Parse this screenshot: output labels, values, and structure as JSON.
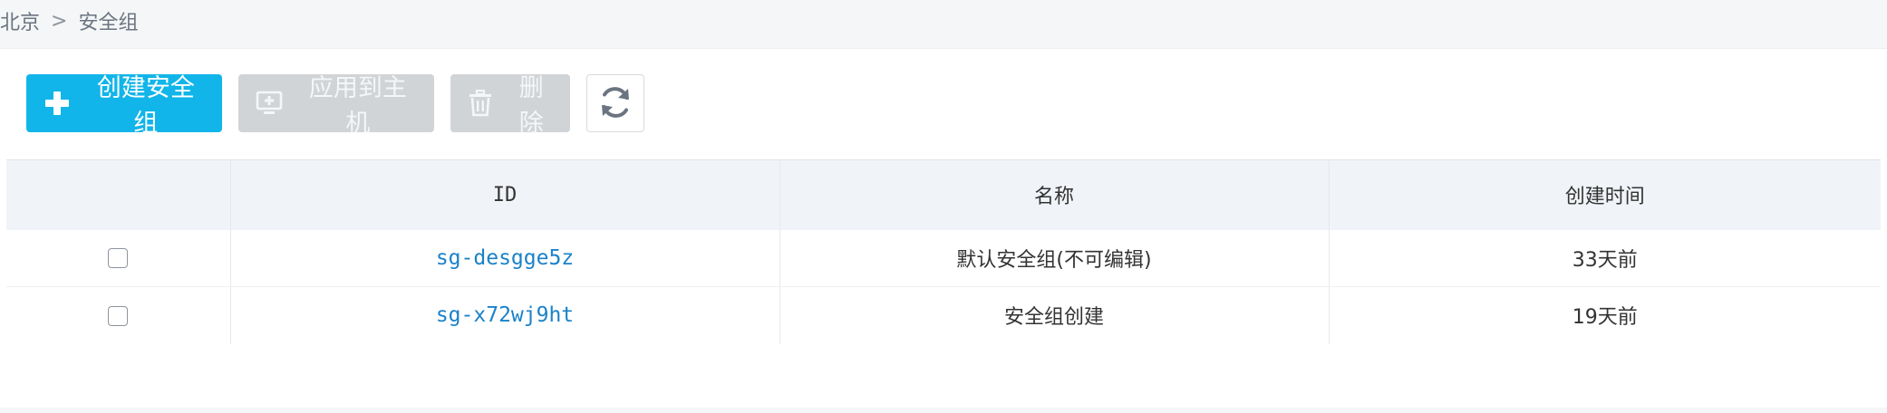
{
  "breadcrumb": {
    "region": "北京",
    "separator": ">",
    "current": "安全组"
  },
  "toolbar": {
    "create_label": "创建安全组",
    "apply_label": "应用到主机",
    "delete_label": "删除"
  },
  "table": {
    "headers": {
      "id": "ID",
      "name": "名称",
      "created": "创建时间"
    },
    "rows": [
      {
        "id": "sg-desgge5z",
        "name": "默认安全组(不可编辑)",
        "created": "33天前"
      },
      {
        "id": "sg-x72wj9ht",
        "name": "安全组创建",
        "created": "19天前"
      }
    ]
  },
  "colors": {
    "primary": "#11b5e9",
    "disabled": "#d1d4d7",
    "link": "#1a82c8"
  }
}
